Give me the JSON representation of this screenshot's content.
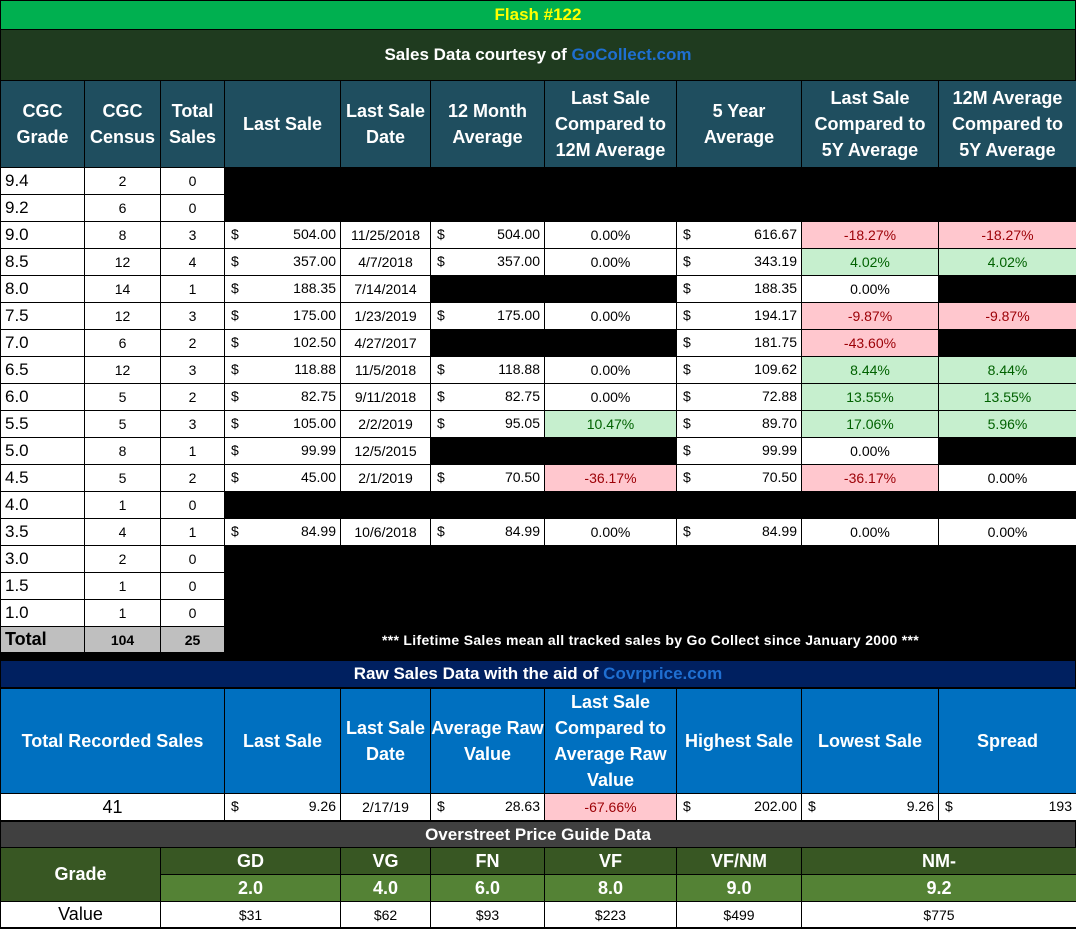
{
  "title": "Flash #122",
  "subtitle_prefix": "Sales Data courtesy of ",
  "subtitle_link": "GoCollect.com",
  "headers": [
    "CGC Grade",
    "CGC Census",
    "Total Sales",
    "Last Sale",
    "Last Sale Date",
    "12 Month Average",
    "Last Sale Compared to 12M Average",
    "5 Year Average",
    "Last Sale Compared to 5Y Average",
    "12M Average Compared to 5Y Average"
  ],
  "rows": [
    {
      "grade": "9.4",
      "census": "2",
      "sales": "0"
    },
    {
      "grade": "9.2",
      "census": "6",
      "sales": "0"
    },
    {
      "grade": "9.0",
      "census": "8",
      "sales": "3",
      "last": "504.00",
      "date": "11/25/2018",
      "avg12": "504.00",
      "cmp12": "0.00%",
      "avg5": "616.67",
      "cmp5": "-18.27%",
      "cmp5s": "red",
      "avgcmp": "-18.27%",
      "avgcmps": "red"
    },
    {
      "grade": "8.5",
      "census": "12",
      "sales": "4",
      "last": "357.00",
      "date": "4/7/2018",
      "avg12": "357.00",
      "cmp12": "0.00%",
      "avg5": "343.19",
      "cmp5": "4.02%",
      "cmp5s": "green",
      "avgcmp": "4.02%",
      "avgcmps": "green"
    },
    {
      "grade": "8.0",
      "census": "14",
      "sales": "1",
      "last": "188.35",
      "date": "7/14/2014",
      "avg5": "188.35",
      "cmp5": "0.00%"
    },
    {
      "grade": "7.5",
      "census": "12",
      "sales": "3",
      "last": "175.00",
      "date": "1/23/2019",
      "avg12": "175.00",
      "cmp12": "0.00%",
      "avg5": "194.17",
      "cmp5": "-9.87%",
      "cmp5s": "red",
      "avgcmp": "-9.87%",
      "avgcmps": "red"
    },
    {
      "grade": "7.0",
      "census": "6",
      "sales": "2",
      "last": "102.50",
      "date": "4/27/2017",
      "avg5": "181.75",
      "cmp5": "-43.60%",
      "cmp5s": "red"
    },
    {
      "grade": "6.5",
      "census": "12",
      "sales": "3",
      "last": "118.88",
      "date": "11/5/2018",
      "avg12": "118.88",
      "cmp12": "0.00%",
      "avg5": "109.62",
      "cmp5": "8.44%",
      "cmp5s": "green",
      "avgcmp": "8.44%",
      "avgcmps": "green"
    },
    {
      "grade": "6.0",
      "census": "5",
      "sales": "2",
      "last": "82.75",
      "date": "9/11/2018",
      "avg12": "82.75",
      "cmp12": "0.00%",
      "avg5": "72.88",
      "cmp5": "13.55%",
      "cmp5s": "green",
      "avgcmp": "13.55%",
      "avgcmps": "green"
    },
    {
      "grade": "5.5",
      "census": "5",
      "sales": "3",
      "last": "105.00",
      "date": "2/2/2019",
      "avg12": "95.05",
      "cmp12": "10.47%",
      "cmp12s": "green",
      "avg5": "89.70",
      "cmp5": "17.06%",
      "cmp5s": "green",
      "avgcmp": "5.96%",
      "avgcmps": "green"
    },
    {
      "grade": "5.0",
      "census": "8",
      "sales": "1",
      "last": "99.99",
      "date": "12/5/2015",
      "avg5": "99.99",
      "cmp5": "0.00%"
    },
    {
      "grade": "4.5",
      "census": "5",
      "sales": "2",
      "last": "45.00",
      "date": "2/1/2019",
      "avg12": "70.50",
      "cmp12": "-36.17%",
      "cmp12s": "red",
      "avg5": "70.50",
      "cmp5": "-36.17%",
      "cmp5s": "red",
      "avgcmp": "0.00%"
    },
    {
      "grade": "4.0",
      "census": "1",
      "sales": "0"
    },
    {
      "grade": "3.5",
      "census": "4",
      "sales": "1",
      "last": "84.99",
      "date": "10/6/2018",
      "avg12": "84.99",
      "cmp12": "0.00%",
      "avg5": "84.99",
      "cmp5": "0.00%",
      "avgcmp": "0.00%"
    },
    {
      "grade": "3.0",
      "census": "2",
      "sales": "0"
    },
    {
      "grade": "1.5",
      "census": "1",
      "sales": "0"
    },
    {
      "grade": "1.0",
      "census": "1",
      "sales": "0"
    }
  ],
  "total": {
    "label": "Total",
    "census": "104",
    "sales": "25",
    "note": "*** Lifetime Sales mean all tracked sales by Go Collect since January 2000 ***"
  },
  "raw": {
    "title_prefix": "Raw Sales Data with the aid of ",
    "title_link": "Covrprice.com",
    "headers": [
      "Total Recorded Sales",
      "Last Sale",
      "Last Sale Date",
      "Average Raw Value",
      "Last Sale Compared to Average Raw Value",
      "Highest Sale",
      "Lowest Sale",
      "Spread"
    ],
    "values": {
      "total": "41",
      "last": "9.26",
      "date": "2/17/19",
      "avg": "28.63",
      "cmp": "-67.66%",
      "high": "202.00",
      "low": "9.26",
      "spread": "193"
    }
  },
  "guide": {
    "title": "Overstreet Price Guide Data",
    "grade_label": "Grade",
    "value_label": "Value",
    "cols": [
      {
        "name": "GD",
        "num": "2.0",
        "value": "$31"
      },
      {
        "name": "VG",
        "num": "4.0",
        "value": "$62"
      },
      {
        "name": "FN",
        "num": "6.0",
        "value": "$93"
      },
      {
        "name": "VF",
        "num": "8.0",
        "value": "$223"
      },
      {
        "name": "VF/NM",
        "num": "9.0",
        "value": "$499"
      },
      {
        "name": "NM-",
        "num": "9.2",
        "value": "$775"
      }
    ]
  },
  "currency_symbol": "$",
  "colors": {
    "title_green": "#00b050",
    "dark_green": "#1f3b1f",
    "header_teal": "#1f4e5f",
    "blue": "#0070c0",
    "navy": "#002060",
    "gray": "#404040",
    "guide_green": "#385723",
    "guide_light": "#548235",
    "total_gray": "#bfbfbf"
  }
}
